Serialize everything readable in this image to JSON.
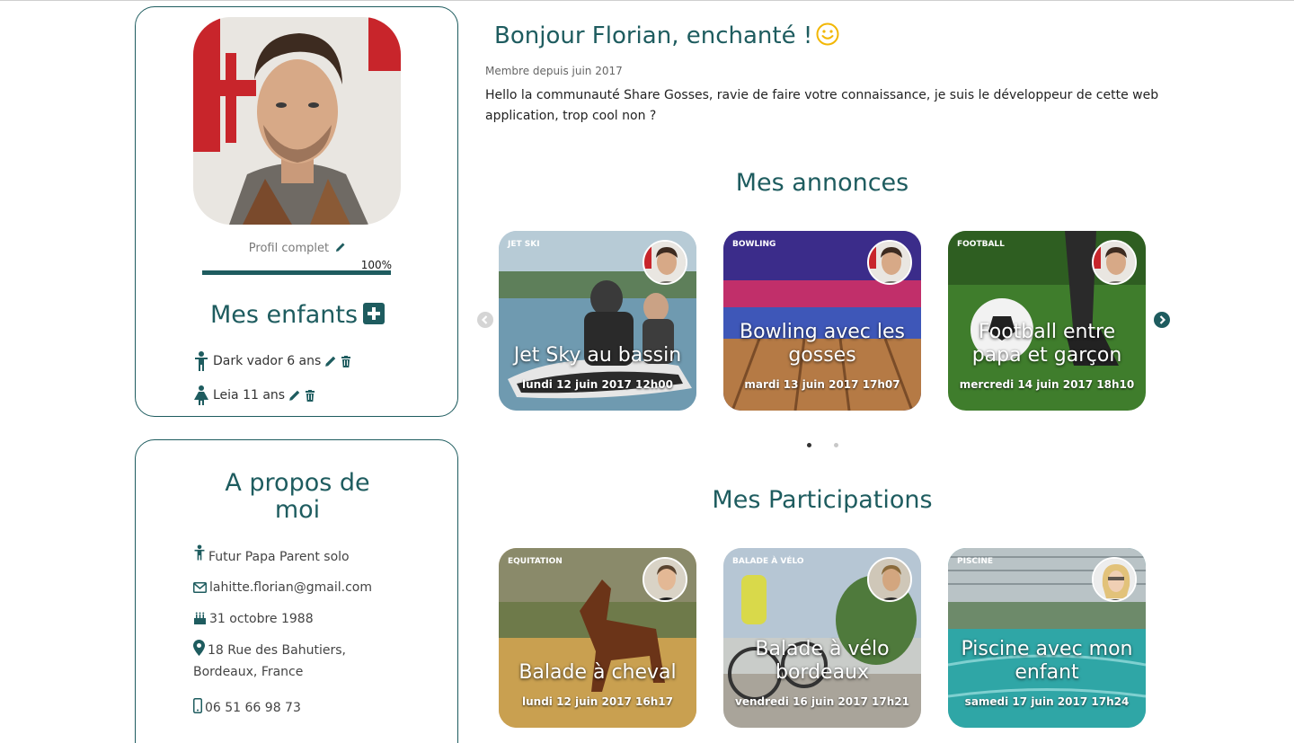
{
  "colors": {
    "accent": "#1e5c5f",
    "smiley": "#f2b705",
    "dot_active": "#333333",
    "dot_inactive": "#c8c8c8"
  },
  "profile": {
    "progress_label": "Profil complet",
    "progress_value": "100%",
    "progress_fraction": 1.0
  },
  "kids": {
    "title": "Mes enfants",
    "items": [
      {
        "name": "Dark vador 6 ans",
        "icon": "boy-icon"
      },
      {
        "name": "Leia 11 ans",
        "icon": "girl-icon"
      }
    ]
  },
  "about": {
    "title_line1": "A propos de",
    "title_line2": "moi",
    "status": "Futur Papa Parent solo",
    "email": "lahitte.florian@gmail.com",
    "birthday": "31 octobre 1988",
    "address_line1": "18 Rue des Bahutiers,",
    "address_line2": "Bordeaux, France",
    "phone": "06 51 66 98 73"
  },
  "header": {
    "greeting": "Bonjour Florian, enchanté !",
    "member_since": "Membre depuis juin 2017",
    "bio": "Hello la communauté Share Gosses, ravie de faire votre connaissance, je suis le développeur de cette web application, trop cool non ?"
  },
  "annonces": {
    "title": "Mes annonces",
    "items": [
      {
        "category": "JET SKI",
        "title_line1": "Jet Sky au bassin",
        "title_line2": "",
        "date": "lundi 12 juin 2017 12h00"
      },
      {
        "category": "BOWLING",
        "title_line1": "Bowling avec les",
        "title_line2": "gosses",
        "date": "mardi 13 juin 2017 17h07"
      },
      {
        "category": "FOOTBALL",
        "title_line1": "Football entre",
        "title_line2": "papa et garçon",
        "date": "mercredi 14 juin 2017 18h10"
      }
    ]
  },
  "participations": {
    "title": "Mes Participations",
    "items": [
      {
        "category": "EQUITATION",
        "title_line1": "Balade à cheval",
        "title_line2": "",
        "date": "lundi 12 juin 2017 16h17"
      },
      {
        "category": "BALADE À VÉLO",
        "title_line1": "Balade à vélo",
        "title_line2": "bordeaux",
        "date": "vendredi 16 juin 2017 17h21"
      },
      {
        "category": "PISCINE",
        "title_line1": "Piscine avec mon",
        "title_line2": "enfant",
        "date": "samedi 17 juin 2017 17h24"
      }
    ]
  }
}
